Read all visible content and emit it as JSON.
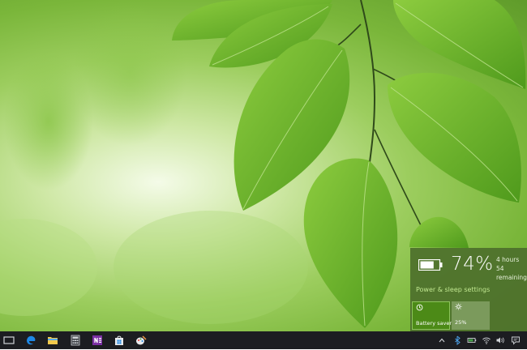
{
  "battery_flyout": {
    "percent": "74%",
    "remaining_line1": "4 hours 54",
    "remaining_line2": "remaining",
    "settings_link": "Power & sleep settings",
    "battery_level": 0.74,
    "tiles": [
      {
        "label": "Battery saver",
        "icon": "battery-saver-icon",
        "active": true
      },
      {
        "label": "25%",
        "icon": "brightness-icon",
        "active": false
      }
    ]
  },
  "taskbar": {
    "pinned": [
      "task-view-icon",
      "edge-icon",
      "file-explorer-icon",
      "calculator-icon",
      "onenote-icon",
      "store-icon",
      "paint-icon"
    ],
    "tray": [
      "chevron-up-icon",
      "bluetooth-icon",
      "battery-icon",
      "wifi-icon",
      "volume-icon",
      "action-center-icon"
    ]
  },
  "colors": {
    "flyout_bg": "#4e702c",
    "link": "#bfe68f",
    "tile_active": "#4c8a17",
    "taskbar": "#1c1d21",
    "edge_blue": "#1e88e5",
    "onenote_purple": "#7b2fa3"
  }
}
